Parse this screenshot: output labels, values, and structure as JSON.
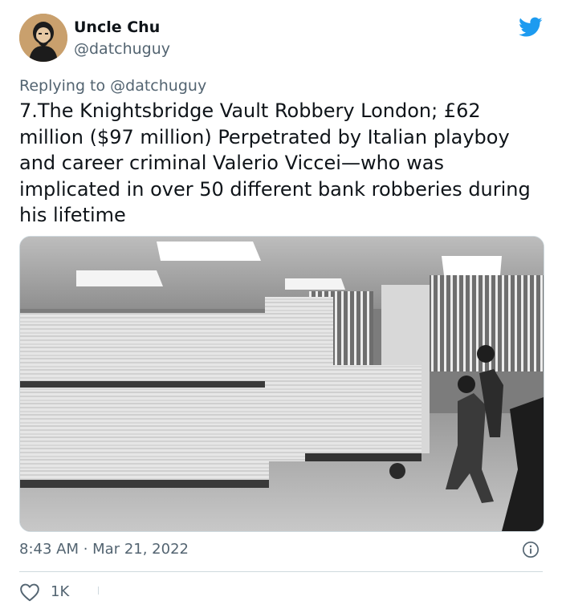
{
  "author": {
    "name": "Uncle Chu",
    "handle": "@datchuguy"
  },
  "reply": {
    "prefix": "Replying to ",
    "mention": "@datchuguy"
  },
  "tweet": {
    "text": "7.The Knightsbridge Vault Robbery London; £62 million ($97 million) Perpetrated by Italian playboy and career criminal Valerio Viccei—who was implicated in over 50 different bank robberies during his lifetime"
  },
  "meta": {
    "timestamp": "8:43 AM · Mar 21, 2022"
  },
  "stats": {
    "likes": "1K"
  },
  "icons": {
    "brand": "twitter-bird-icon",
    "info": "info-icon",
    "like": "heart-icon"
  },
  "colors": {
    "brand": "#1d9bf0",
    "secondary": "#536471",
    "text": "#0f1419"
  }
}
